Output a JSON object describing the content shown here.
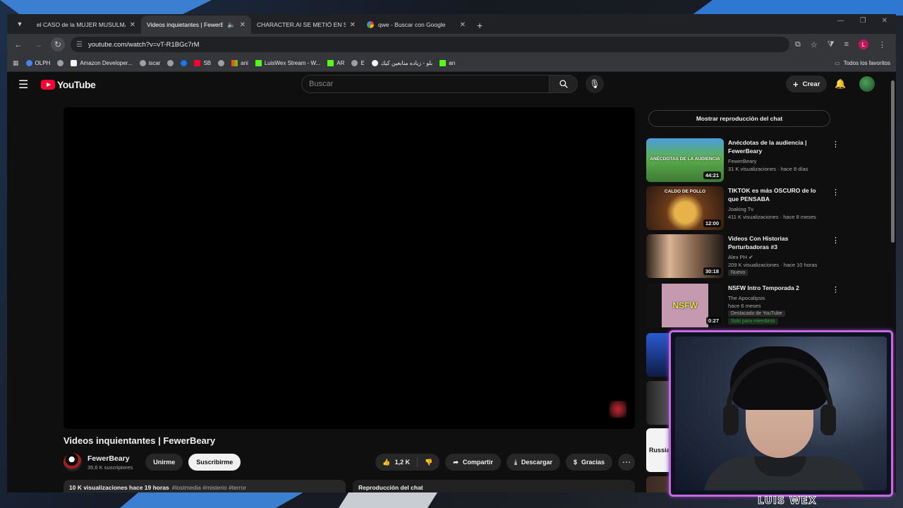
{
  "browser": {
    "tabs": [
      {
        "title": "el CASO de la MUJER MUSULMAN",
        "favicon": "youtube-icon",
        "active": false
      },
      {
        "title": "Videos inquietantes | FewerBeary",
        "favicon": "youtube-icon",
        "active": true
      },
      {
        "title": "CHARACTER.AI SE METIÓ EN SUS",
        "favicon": "youtube-icon",
        "active": false
      },
      {
        "title": "qwe - Buscar con Google",
        "favicon": "google-icon",
        "active": false
      }
    ],
    "new_tab": "+",
    "url": "youtube.com/watch?v=vT-R1BGc7rM",
    "bookmarks": [
      {
        "label": "OLPH",
        "color": "#4285f4"
      },
      {
        "label": "",
        "color": "#9aa0a6"
      },
      {
        "label": "Amazon Developer...",
        "color": "#f5f5f5"
      },
      {
        "label": "iscar",
        "color": "#9aa0a6"
      },
      {
        "label": "",
        "color": "#9aa0a6"
      },
      {
        "label": "",
        "color": "#1877f2"
      },
      {
        "label": "SB",
        "color": "#ff0033"
      },
      {
        "label": "",
        "color": "#9aa0a6"
      },
      {
        "label": "ani",
        "color": "#7fba00"
      },
      {
        "label": "LuisWex Stream - W...",
        "color": "#53fc18"
      },
      {
        "label": "AR",
        "color": "#53fc18"
      },
      {
        "label": "E",
        "color": "#9aa0a6"
      },
      {
        "label": "بلو - زياده متابعين كيك",
        "color": "#f5f5f5"
      },
      {
        "label": "an",
        "color": "#53fc18"
      }
    ],
    "all_bookmarks": "Todos los favoritos"
  },
  "youtube": {
    "logo": "YouTube",
    "search_placeholder": "Buscar",
    "create_label": "Crear",
    "video": {
      "title": "Videos inquientantes | FewerBeary",
      "channel": "FewerBeary",
      "subscribers": "35,6 K suscriptores",
      "join": "Unirme",
      "subscribe": "Suscribirme",
      "likes": "1,2 K",
      "share": "Compartir",
      "download": "Descargar",
      "thanks": "Gracias",
      "views_line": "10 K visualizaciones  hace 19 horas",
      "tags": "#lostmedia #misterio #terror",
      "chat_replay": "Reproducción del chat"
    },
    "chat_button": "Mostrar reproducción del chat",
    "recommendations": [
      {
        "title": "Anécdotas de la audiencia | FewerBeary",
        "channel": "FewerBeary",
        "meta": "31 K visualizaciones · hace 8 días",
        "duration": "44:21",
        "thumb_caption": "ANÉCDOTAS DE LA AUDIENCIA",
        "badge": "",
        "badge2": ""
      },
      {
        "title": "TIKTOK es más OSCURO de lo que PENSABA",
        "channel": "Joaking Tv",
        "meta": "411 K visualizaciones · hace 8 meses",
        "duration": "12:00",
        "thumb_caption": "CALDO DE POLLO",
        "badge": "",
        "badge2": ""
      },
      {
        "title": "Videos Con Historias Perturbadoras #3",
        "channel": "Alex PH",
        "meta": "209 K visualizaciones · hace 10 horas",
        "duration": "30:18",
        "thumb_caption": "",
        "badge": "Nuevo",
        "badge2": ""
      },
      {
        "title": "NSFW Intro Temporada 2",
        "channel": "The Apocalipsis",
        "meta": "hace 6 meses",
        "duration": "0:27",
        "thumb_caption": "NSFW",
        "badge": "Destacado de YouTube",
        "badge2": "Solo para miembros"
      }
    ],
    "partial_thumb_caption": "Russia"
  },
  "overlay": {
    "streamer_name": "LUIS WEX"
  }
}
